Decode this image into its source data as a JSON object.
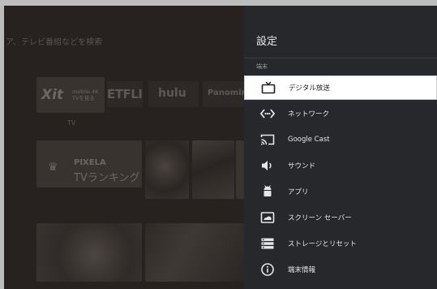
{
  "home": {
    "search_hint": "ア、テレビ番組などを検索",
    "apps": {
      "xit_logo": "Xit",
      "xit_sub_line1": "mobile 4K",
      "xit_sub_line2": "TVを見る",
      "netflix": "ETFLIX",
      "hulu": "hulu",
      "panomiru": "Panomir"
    },
    "tv_label": "TV",
    "ranking": {
      "brand": "PIXELA",
      "title": "TVランキング"
    }
  },
  "settings": {
    "title": "設定",
    "section_label": "端末",
    "items": [
      {
        "label": "デジタル放送",
        "icon": "tv-icon",
        "selected": true
      },
      {
        "label": "ネットワーク",
        "icon": "network-icon",
        "selected": false
      },
      {
        "label": "Google Cast",
        "icon": "cast-icon",
        "selected": false
      },
      {
        "label": "サウンド",
        "icon": "volume-icon",
        "selected": false
      },
      {
        "label": "アプリ",
        "icon": "android-icon",
        "selected": false
      },
      {
        "label": "スクリーン セーバー",
        "icon": "screensaver-icon",
        "selected": false
      },
      {
        "label": "ストレージとリセット",
        "icon": "storage-icon",
        "selected": false
      },
      {
        "label": "端末情報",
        "icon": "info-icon",
        "selected": false
      }
    ]
  },
  "colors": {
    "panel_bg": "#26282b",
    "selected_bg": "#ffffff",
    "home_dim_bg": "#272220"
  }
}
